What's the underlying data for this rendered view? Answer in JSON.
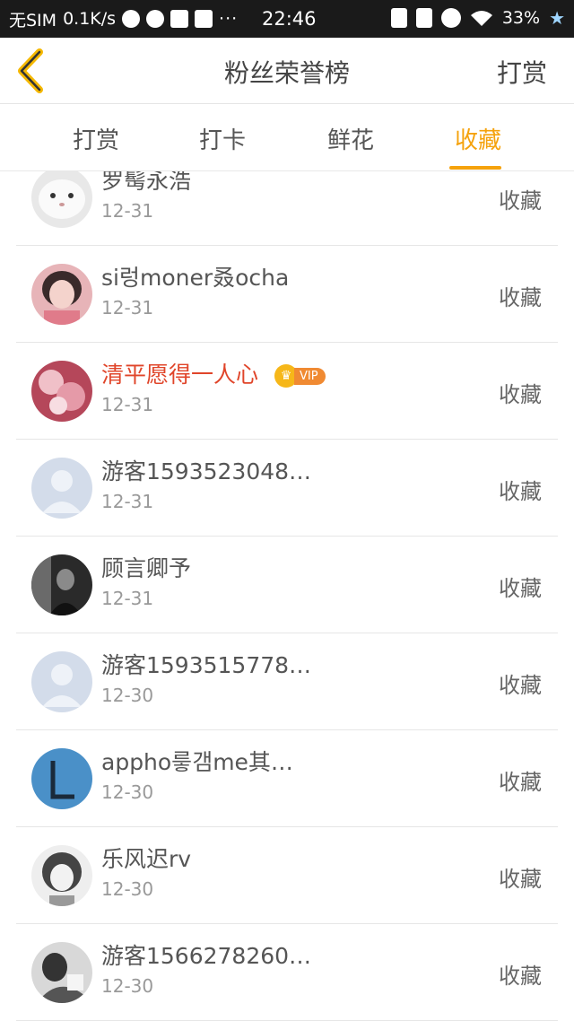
{
  "status_bar": {
    "carrier": "无SIM",
    "speed": "0.1K/s",
    "dots": "···",
    "time": "22:46",
    "battery": "33%"
  },
  "header": {
    "title": "粉丝荣誉榜",
    "right_label": "打赏"
  },
  "tabs": [
    {
      "label": "打赏",
      "active": false
    },
    {
      "label": "打卡",
      "active": false
    },
    {
      "label": "鲜花",
      "active": false
    },
    {
      "label": "收藏",
      "active": true
    }
  ],
  "colors": {
    "accent": "#f5a20c",
    "vip_name": "#e0452a",
    "vip_badge": "#f08a32"
  },
  "rows": [
    {
      "name": "罗髩永浩",
      "date": "12-31",
      "action": "收藏",
      "vip": false,
      "avatar": "white-cat"
    },
    {
      "name": "si렁moner叒ocha",
      "date": "12-31",
      "action": "收藏",
      "vip": false,
      "avatar": "girl-pink"
    },
    {
      "name": "清平愿得一人心",
      "date": "12-31",
      "action": "收藏",
      "vip": true,
      "vip_label": "VIP",
      "avatar": "pink-flowers"
    },
    {
      "name": "游客1593523048…",
      "date": "12-31",
      "action": "收藏",
      "vip": false,
      "avatar": "default-user"
    },
    {
      "name": "顾言卿予",
      "date": "12-31",
      "action": "收藏",
      "vip": false,
      "avatar": "dark-portrait"
    },
    {
      "name": "游客1593515778…",
      "date": "12-30",
      "action": "收藏",
      "vip": false,
      "avatar": "default-user"
    },
    {
      "name": "appho릏갬me其…",
      "date": "12-30",
      "action": "收藏",
      "vip": false,
      "avatar": "letter-l-blue"
    },
    {
      "name": "乐风迟rv",
      "date": "12-30",
      "action": "收藏",
      "vip": false,
      "avatar": "girl-bw"
    },
    {
      "name": "游客1566278260…",
      "date": "12-30",
      "action": "收藏",
      "vip": false,
      "avatar": "bw-photo"
    }
  ]
}
